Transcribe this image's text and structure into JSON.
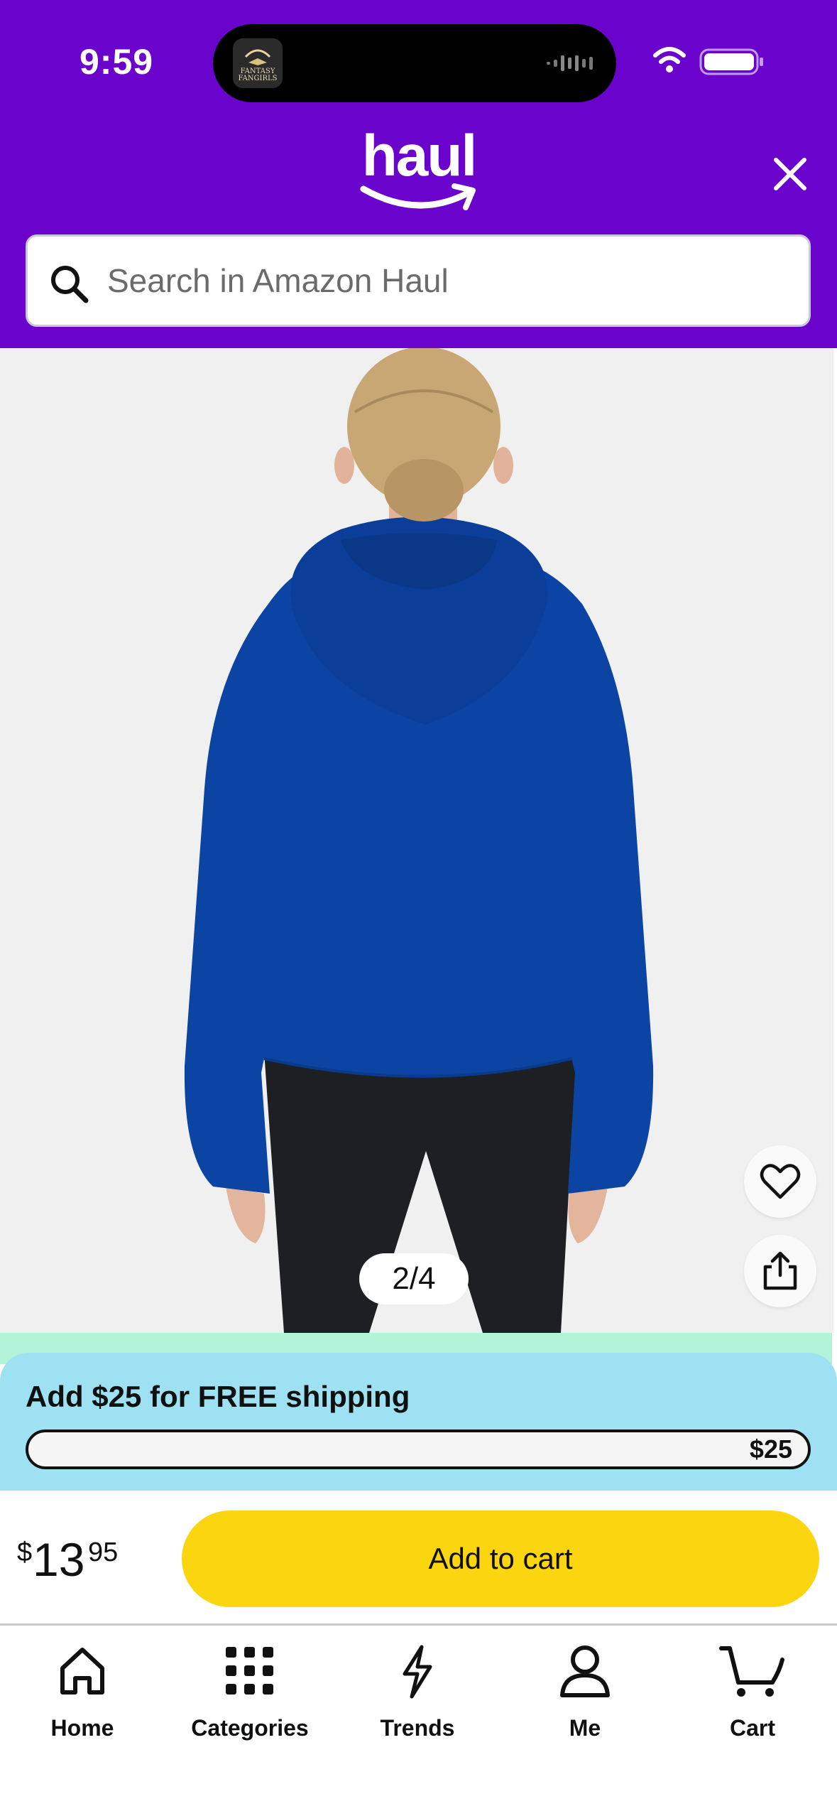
{
  "status_bar": {
    "time": "9:59",
    "island_app_text": "FANTASY FANGIRLS"
  },
  "header": {
    "logo_text": "haul",
    "brand_color": "#6a04cc"
  },
  "search": {
    "placeholder": "Search in Amazon Haul"
  },
  "gallery": {
    "page_indicator": "2/4",
    "current_index": 2,
    "total": 4
  },
  "shipping": {
    "title": "Add $25 for FREE shipping",
    "target_label": "$25",
    "progress": 0.0
  },
  "price": {
    "currency": "$",
    "whole": "13",
    "fraction": "95"
  },
  "cart_button": {
    "label": "Add to cart",
    "color": "#fbd50f"
  },
  "nav": {
    "items": [
      {
        "label": "Home",
        "icon": "home-icon"
      },
      {
        "label": "Categories",
        "icon": "grid-icon"
      },
      {
        "label": "Trends",
        "icon": "lightning-icon"
      },
      {
        "label": "Me",
        "icon": "person-icon"
      },
      {
        "label": "Cart",
        "icon": "cart-icon"
      }
    ]
  }
}
